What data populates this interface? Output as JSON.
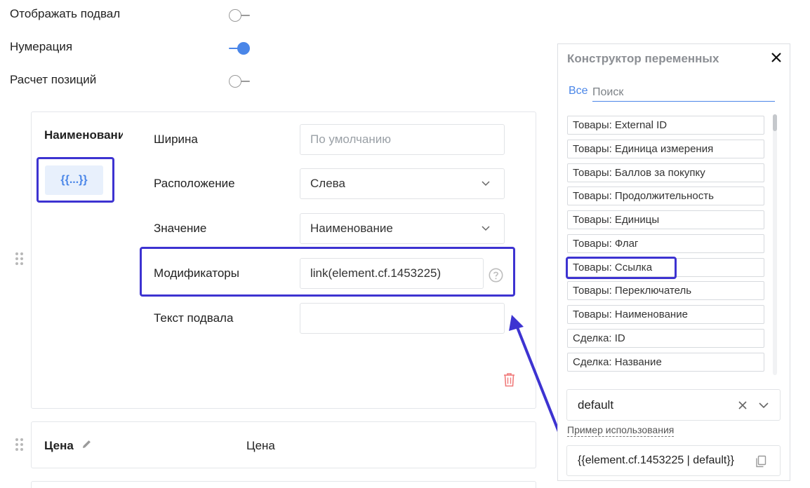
{
  "toggles": [
    {
      "label": "Отображать подвал",
      "state": "off"
    },
    {
      "label": "Нумерация",
      "state": "on"
    },
    {
      "label": "Расчет позиций",
      "state": "off"
    }
  ],
  "column_card": {
    "title": "Наименовани",
    "variable_button": "{{...}}",
    "fields": {
      "width_label": "Ширина",
      "width_placeholder": "По умолчанию",
      "position_label": "Расположение",
      "position_value": "Слева",
      "value_label": "Значение",
      "value_value": "Наименование",
      "modifiers_label": "Модификаторы",
      "modifiers_value": "link(element.cf.1453225)",
      "footer_text_label": "Текст подвала",
      "footer_text_value": ""
    }
  },
  "price_card": {
    "title": "Цена",
    "value": "Цена"
  },
  "panel": {
    "title": "Конструктор переменных",
    "tab_all": "Все",
    "search_placeholder": "Поиск",
    "items": [
      "Товары: External ID",
      "Товары: Единица измерения",
      "Товары: Баллов за покупку",
      "Товары: Продолжительность",
      "Товары: Единицы",
      "Товары: Флаг",
      "Товары: Ссылка",
      "Товары: Переключатель",
      "Товары: Наименование",
      "Сделка: ID",
      "Сделка: Название"
    ],
    "selected_default": "default",
    "example_label": "Пример использования",
    "example_value": "{{element.cf.1453225 | default}}"
  },
  "colors": {
    "accent": "#4a86e8",
    "highlight": "#3d33d1",
    "delete": "#f07a7a"
  }
}
